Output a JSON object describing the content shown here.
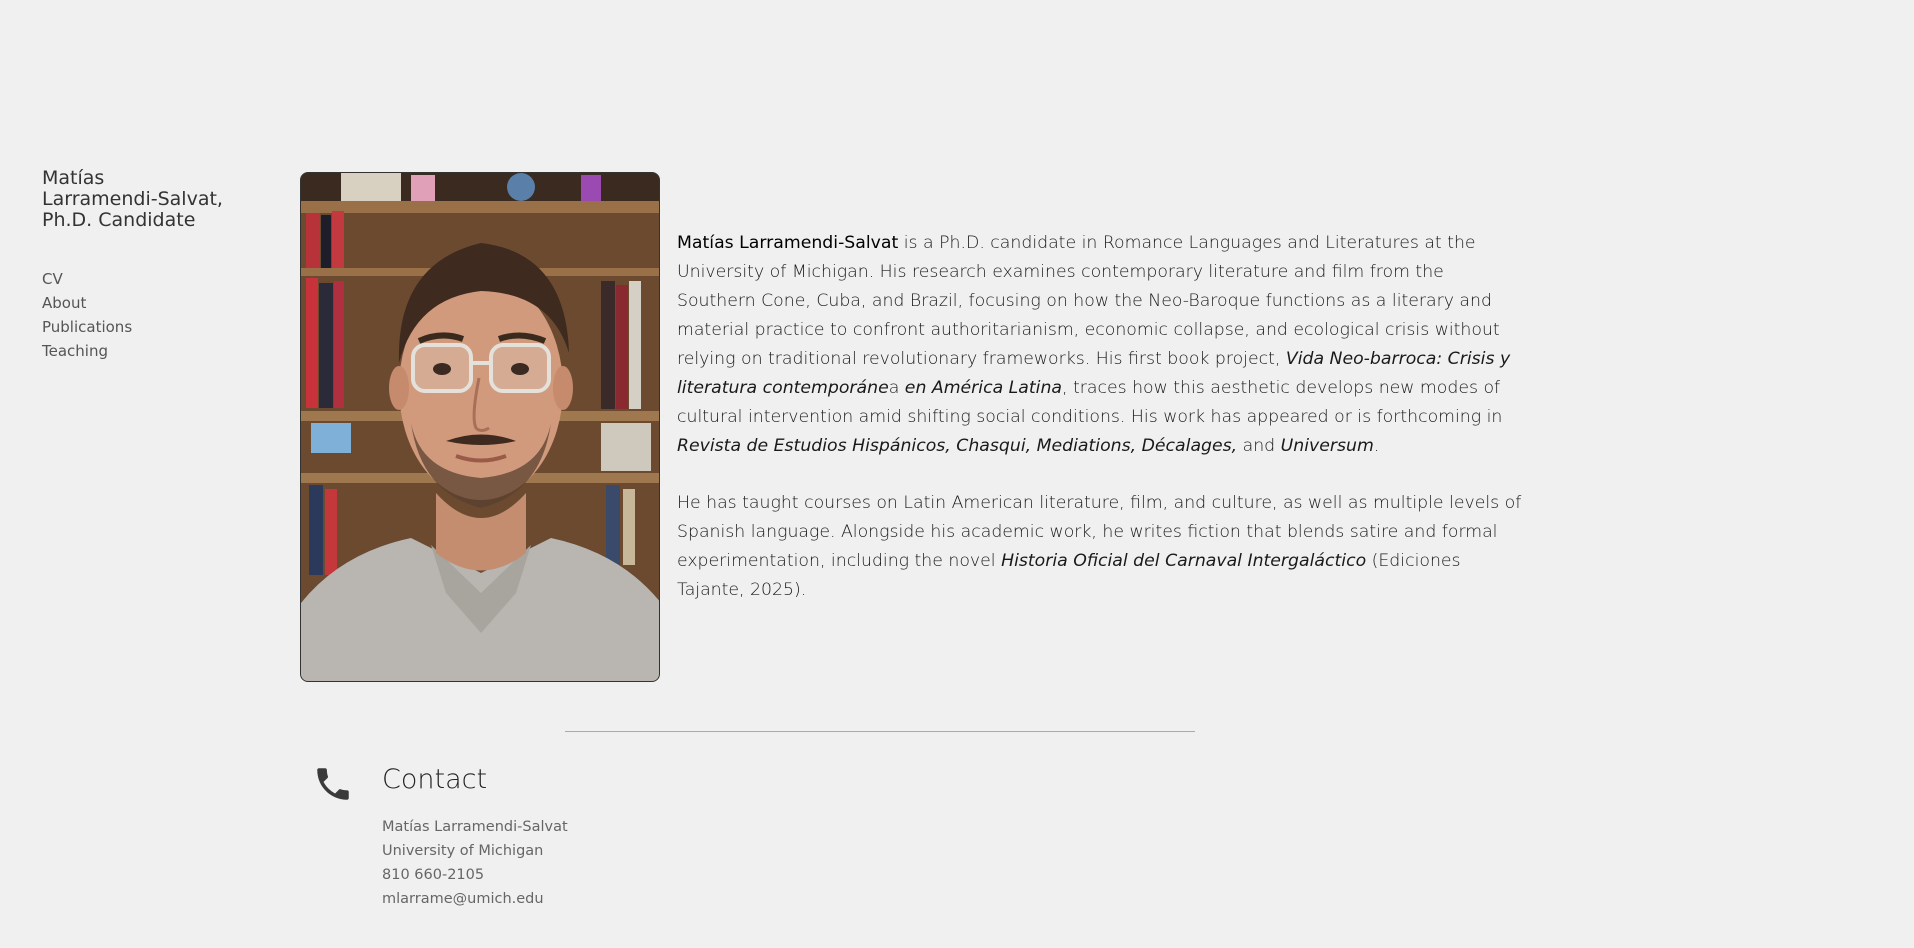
{
  "sidebar": {
    "title_lines": [
      "Matías",
      "Larramendi-Salvat,",
      "Ph.D. Candidate"
    ],
    "nav": [
      {
        "label": "CV"
      },
      {
        "label": "About"
      },
      {
        "label": "Publications"
      },
      {
        "label": "Teaching"
      }
    ]
  },
  "bio": {
    "p1": {
      "name": "Matías Larramendi-Salvat",
      "t1": " is a Ph.D. candidate in Romance Languages and Literatures at the University of Michigan. His research examines contemporary literature and film from the Southern Cone, Cuba, and Brazil, focusing on how the Neo-Baroque functions as a literary and material practice to confront authoritarianism, economic collapse, and ecological crisis without relying on traditional revolutionary frameworks. His first book project, ",
      "book_a": "Vida Neo-barroca: Crisis y literatura contemporáne",
      "book_b": "a",
      "book_c": " en América Latina",
      "t2": ", traces how this aesthetic develops new modes of cultural intervention amid shifting social conditions. His work has appeared or is forthcoming in ",
      "journals": "Revista de Estudios Hispánicos, Chasqui, Mediations, Décalages,",
      "t3": " and ",
      "journal_last": "Universum",
      "t4": "."
    },
    "p2": {
      "t1": "He has taught courses on Latin American literature, film, and culture, as well as multiple levels of Spanish language. Alongside his academic work, he writes fiction that blends satire and formal experimentation, including the novel ",
      "novel": "Historia Oficial del Carnaval Intergaláctico",
      "t2": " (Ediciones Tajante, 2025)."
    }
  },
  "contact": {
    "icon": "phone-icon",
    "title": "Contact",
    "lines": [
      "Matías Larramendi-Salvat",
      "University of Michigan",
      "810 660-2105",
      "mlarrame@umich.edu"
    ]
  }
}
